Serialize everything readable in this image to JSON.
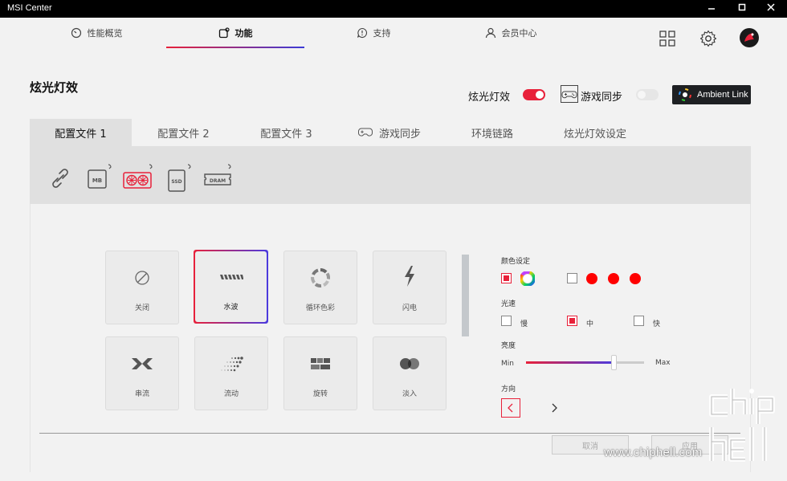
{
  "window": {
    "title": "MSI Center"
  },
  "nav": {
    "tabs": [
      {
        "label": "性能概览",
        "icon": "gauge-icon"
      },
      {
        "label": "功能",
        "icon": "feature-icon"
      },
      {
        "label": "支持",
        "icon": "support-icon"
      },
      {
        "label": "会员中心",
        "icon": "member-icon"
      }
    ],
    "active_tab": "功能"
  },
  "page": {
    "title": "炫光灯效",
    "rgb_toggle_label": "炫光灯效",
    "rgb_toggle_on": true,
    "game_sync_label": "游戏同步",
    "game_sync_on": false,
    "ambient_link_label": "Ambient Link"
  },
  "subtabs": [
    "配置文件 1",
    "配置文件 2",
    "配置文件 3",
    "游戏同步",
    "环境链路",
    "炫光灯效设定"
  ],
  "devices": [
    "link-icon",
    "MB",
    "gpu-icon",
    "SSD",
    "DRAM"
  ],
  "effects": [
    {
      "label": "关闭",
      "icon": "off-icon"
    },
    {
      "label": "水波",
      "icon": "wave-icon",
      "selected": true
    },
    {
      "label": "循环色彩",
      "icon": "color-cycle-icon"
    },
    {
      "label": "闪电",
      "icon": "lightning-icon"
    },
    {
      "label": "串流",
      "icon": "stream-icon"
    },
    {
      "label": "流动",
      "icon": "flow-icon"
    },
    {
      "label": "旋转",
      "icon": "rotate-icon"
    },
    {
      "label": "淡入",
      "icon": "fade-in-icon"
    }
  ],
  "settings": {
    "color_label": "颜色设定",
    "speed_label": "光速",
    "speed_options": [
      "慢",
      "中",
      "快"
    ],
    "speed_selected": "中",
    "brightness_label": "亮度",
    "brightness_min": "Min",
    "brightness_max": "Max",
    "brightness_value": 0.75,
    "direction_label": "方向",
    "colors": {
      "accent": "#e8213a",
      "preset": "#ff0000"
    }
  },
  "footer": {
    "cancel_label": "取消",
    "apply_label": "应用"
  },
  "watermark": {
    "text": "www.chiphell.com"
  }
}
